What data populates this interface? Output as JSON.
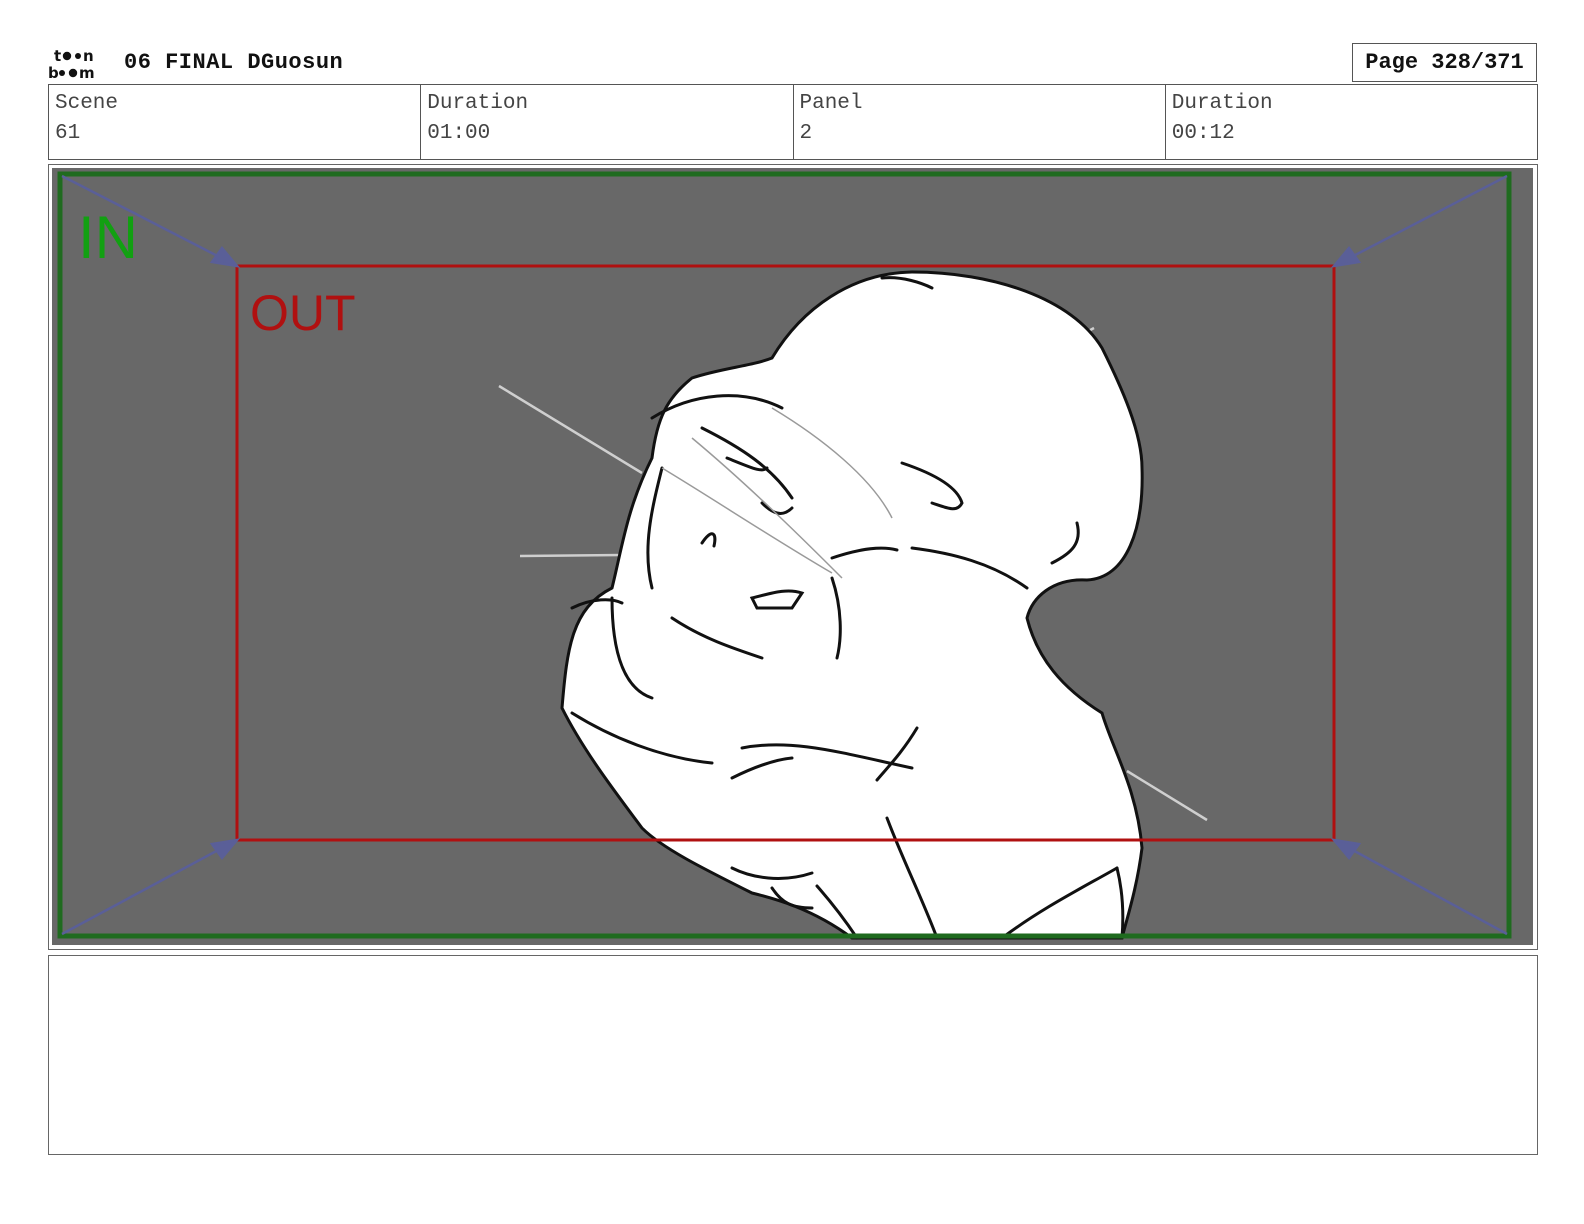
{
  "header": {
    "logo_text": "toon boom",
    "document_title": "06 FINAL DGuosun",
    "page_label": "Page 328/371"
  },
  "info": {
    "scene_label": "Scene",
    "scene_value": "61",
    "scene_duration_label": "Duration",
    "scene_duration_value": "01:00",
    "panel_label": "Panel",
    "panel_value": "2",
    "panel_duration_label": "Duration",
    "panel_duration_value": "00:12"
  },
  "panel": {
    "in_label": "IN",
    "out_label": "OUT",
    "colors": {
      "background": "#686868",
      "in_frame": "#1f6b1f",
      "in_text": "#12a012",
      "out_frame": "#b01010",
      "arrows": "#5a5f98"
    }
  },
  "notes": {
    "text": ""
  }
}
